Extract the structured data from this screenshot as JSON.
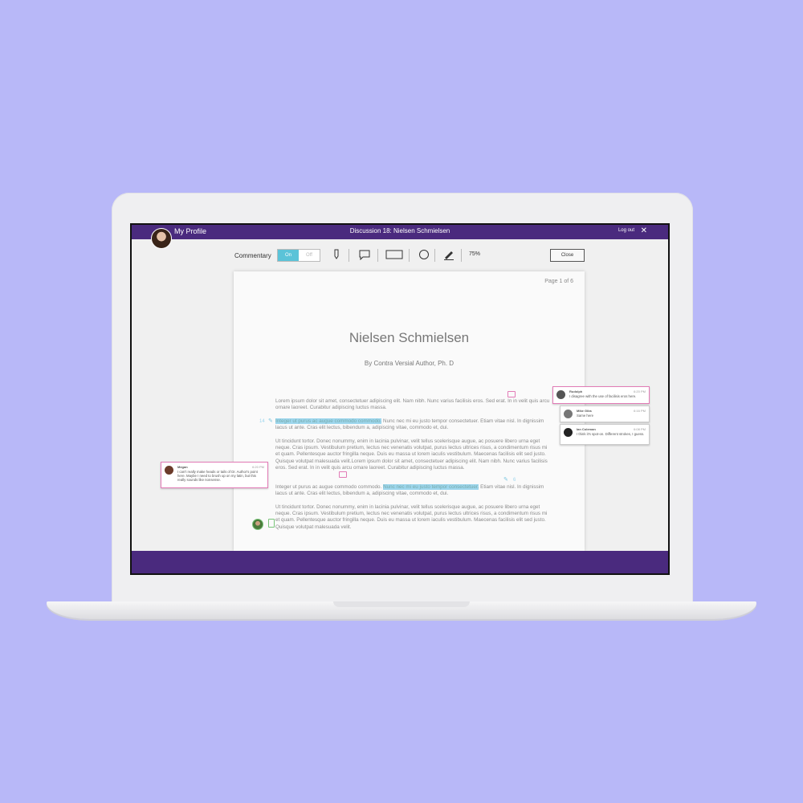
{
  "header": {
    "profile_label": "My Profile",
    "title": "Discussion 18: Nielsen Schmielsen",
    "logout_label": "Log out",
    "close_icon": "close-icon"
  },
  "toolbar": {
    "commentary_label": "Commentary",
    "toggle_on": "On",
    "toggle_off": "Off",
    "tools": [
      "highlighter-icon",
      "comment-icon",
      "rectangle-icon",
      "circle-icon",
      "pen-icon"
    ],
    "zoom": "75%",
    "close_label": "Close"
  },
  "document": {
    "page_indicator": "Page 1 of 6",
    "title": "Nielsen Schmielsen",
    "author": "By Contra Versial Author, Ph. D",
    "p1": "Lorem ipsum dolor sit amet, consectetuer adipiscing elit. Nam nibh. Nunc varius facilisis eros. Sed erat. In in velit quis arcu ornare laoreet. Curabitur adipiscing luctus massa.",
    "p2_highlight": "Integer ut purus ac augue commodo commodo.",
    "p2_rest": " Nunc nec mi eu justo tempor consectetuer. Etiam vitae nisl. In dignissim lacus ut ante. Cras elit lectus, bibendum a, adipiscing vitae, commodo et, dui.",
    "p3": "Ut tincidunt tortor. Donec nonummy, enim in lacinia pulvinar, velit tellus scelerisque augue, ac posuere libero urna eget neque. Cras ipsum. Vestibulum pretium, lectus nec venenatis volutpat, purus lectus ultrices risus, a condimentum risus mi et quam. Pellentesque auctor fringilla neque. Duis eu massa ut lorem iaculis vestibulum. Maecenas facilisis elit sed justo. Quisque volutpat malesuada velit.Lorem ipsum dolor sit amet, consectetuer adipiscing elit. Nam nibh. Nunc varius facilisis eros. Sed erat. In in velit quis arcu ornare laoreet. Curabitur adipiscing luctus massa.",
    "p4_start": "Integer ut purus ac augue commodo commodo. ",
    "p4_highlight": "Nunc nec mi eu justo tempor consectetuer.",
    "p4_rest": " Etiam vitae nisl. In dignissim lacus ut ante. Cras elit lectus, bibendum a, adipiscing vitae, commodo et, dui.",
    "p5": "Ut tincidunt tortor. Donec nonummy, enim in lacinia pulvinar, velit tellus scelerisque augue, ac posuere libero urna eget neque. Cras ipsum. Vestibulum pretium, lectus nec venenatis volutpat, purus lectus ultrices risus, a condimentum risus mi et quam. Pellentesque auctor fringilla neque. Duis eu massa ut lorem iaculis vestibulum. Maecenas facilisis elit sed justo. Quisque volutpat malesuada velit.",
    "highlight_count_1": "14",
    "highlight_count_2": "6"
  },
  "comments": [
    {
      "name": "Rudolph",
      "time": "6:20 PM",
      "text": "I disagree with the use of facilisis eros here."
    },
    {
      "name": "Mike Gibs",
      "time": "6:16 PM",
      "text": "Same here"
    },
    {
      "name": "Ian Coleman",
      "time": "6:08 PM",
      "text": "I think it's spot-on. Different strokes, I guess."
    },
    {
      "name": "Megan",
      "time": "6:20 PM",
      "text": "I can't really make heads or tails of Dr. Author's point here. Maybe I need to brush up on my latin, but this really sounds like nonsense."
    }
  ],
  "colors": {
    "background": "#b8b8f8",
    "header": "#4a2a7e",
    "toggle_on": "#5bc3d8",
    "highlight": "#9ed7ee",
    "comment_marker": "#e27bb6"
  }
}
